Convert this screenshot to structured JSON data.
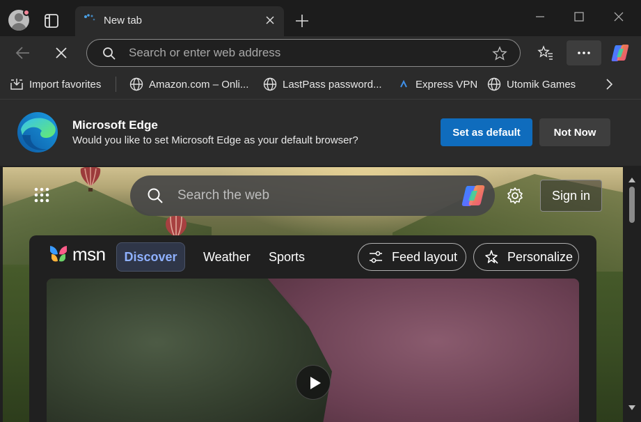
{
  "tabs": [
    {
      "title": "New tab"
    }
  ],
  "omnibox": {
    "placeholder": "Search or enter web address"
  },
  "favorites": [
    {
      "label": "Import favorites",
      "icon": "import-icon"
    },
    {
      "label": "Amazon.com – Onli...",
      "icon": "globe-icon"
    },
    {
      "label": "LastPass password...",
      "icon": "globe-icon"
    },
    {
      "label": "Express VPN",
      "icon": "expressvpn-icon"
    },
    {
      "label": "Utomik Games",
      "icon": "globe-icon"
    }
  ],
  "infobar": {
    "title": "Microsoft Edge",
    "message": "Would you like to set Microsoft Edge as your default browser?",
    "primary_button": "Set as default",
    "secondary_button": "Not Now"
  },
  "newtab_page": {
    "search_placeholder": "Search the web",
    "sign_in": "Sign in"
  },
  "feed": {
    "brand": "msn",
    "tabs": [
      "Discover",
      "Weather",
      "Sports"
    ],
    "active_tab": "Discover",
    "feed_layout_label": "Feed layout",
    "personalize_label": "Personalize"
  },
  "colors": {
    "accent": "#0f6cbd",
    "chrome_bg": "#2b2b2b",
    "tabstrip_bg": "#1c1c1c",
    "discover_text": "#8fb1ff"
  }
}
